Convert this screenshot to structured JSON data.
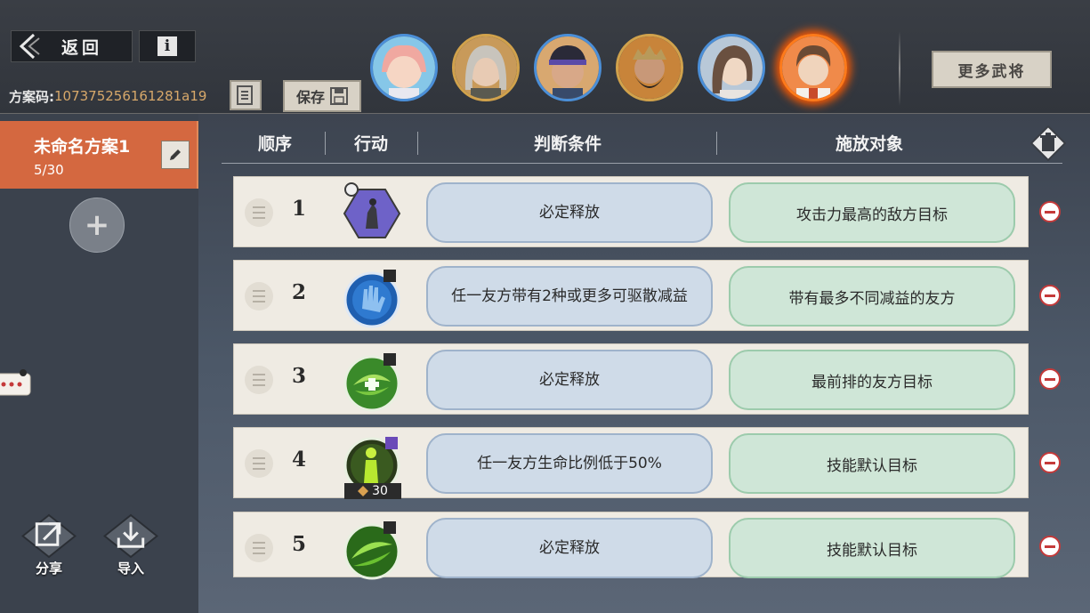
{
  "topbar": {
    "back_label": "返回",
    "info_label": "i",
    "code_label": "方案码:",
    "code_value": "107375256161281a19",
    "save_label": "保存",
    "more_generals_label": "更多武将"
  },
  "portraits": [
    {
      "name": "general-1",
      "border": "blue",
      "color": "#f2b0a8"
    },
    {
      "name": "general-2",
      "border": "gold",
      "color": "#b8b0a0"
    },
    {
      "name": "general-3",
      "border": "blue",
      "color": "#4c5870"
    },
    {
      "name": "general-4",
      "border": "gold",
      "color": "#6a5040"
    },
    {
      "name": "general-5",
      "border": "blue",
      "color": "#8a6a58"
    },
    {
      "name": "general-6",
      "border": "active",
      "color": "#8a5a40"
    }
  ],
  "sidebar": {
    "plan_name": "未命名方案1",
    "plan_count": "5/30",
    "add_label": "+",
    "share_label": "分享",
    "import_label": "导入"
  },
  "table": {
    "headers": {
      "order": "顺序",
      "action": "行动",
      "condition": "判断条件",
      "target": "施放对象"
    },
    "rows": [
      {
        "num": "1",
        "icon": "horseman-skill-icon",
        "condition": "必定释放",
        "target": "攻击力最高的敌方目标"
      },
      {
        "num": "2",
        "icon": "blue-hand-skill-icon",
        "condition": "任一友方带有2种或更多可驱散减益",
        "target": "带有最多不同减益的友方"
      },
      {
        "num": "3",
        "icon": "green-heal-skill-icon",
        "condition": "必定释放",
        "target": "最前排的友方目标"
      },
      {
        "num": "4",
        "icon": "green-figure-skill-icon",
        "condition": "任一友方生命比例低于50%",
        "target": "技能默认目标",
        "badge": "30"
      },
      {
        "num": "5",
        "icon": "green-swirl-skill-icon",
        "condition": "必定释放",
        "target": "技能默认目标"
      }
    ]
  },
  "colors": {
    "accent_orange": "#d46840",
    "condition_bg": "#cfdbe8",
    "target_bg": "#cfe6d7",
    "remove_red": "#c53a3a"
  }
}
